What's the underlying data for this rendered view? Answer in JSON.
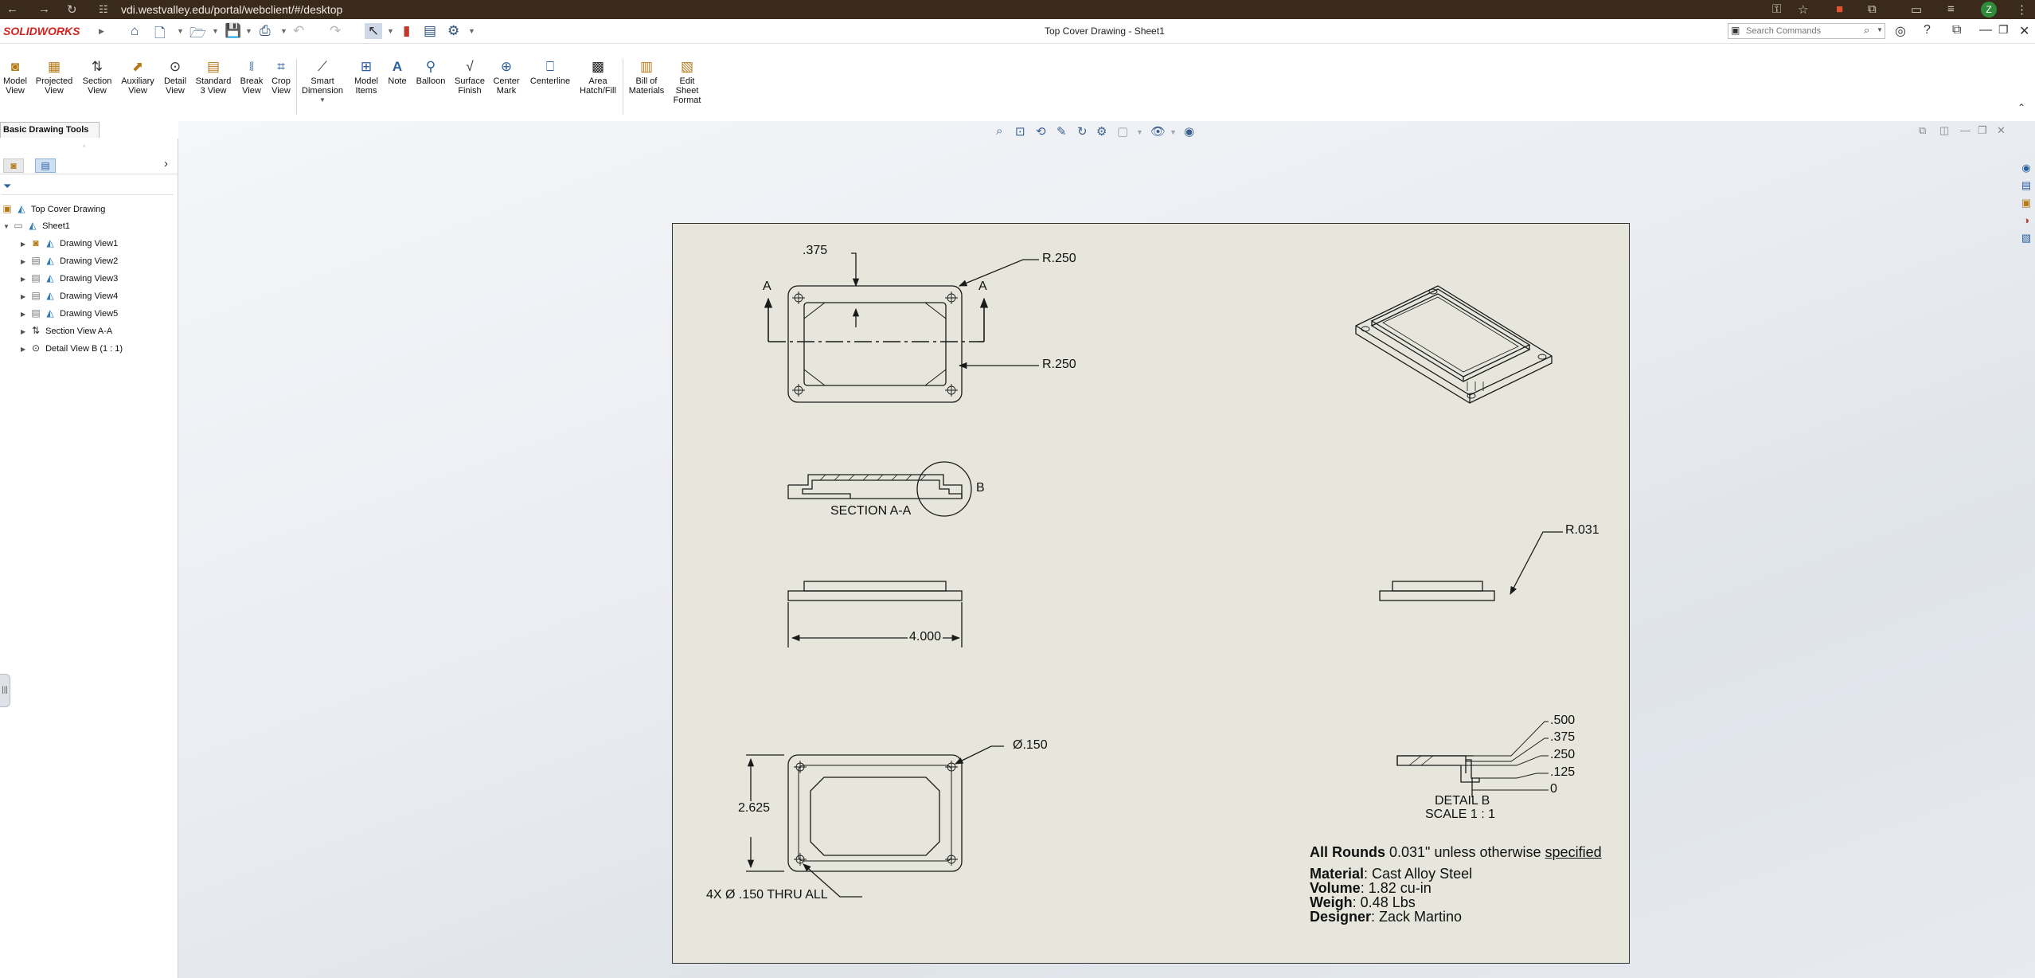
{
  "browser": {
    "url": "vdi.westvalley.edu/portal/webclient/#/desktop",
    "avatar": "Z"
  },
  "app": {
    "logo": "SOLIDWORKS",
    "doc_title": "Top Cover Drawing - Sheet1",
    "search_placeholder": "Search Commands"
  },
  "toolbar": {
    "tools": [
      {
        "label": "Model\nView",
        "icon": "model-view-icon"
      },
      {
        "label": "Projected\nView",
        "icon": "projected-view-icon"
      },
      {
        "label": "Section\nView",
        "icon": "section-view-icon"
      },
      {
        "label": "Auxiliary\nView",
        "icon": "auxiliary-view-icon"
      },
      {
        "label": "Detail\nView",
        "icon": "detail-view-icon"
      },
      {
        "label": "Standard\n3 View",
        "icon": "standard-3-view-icon"
      },
      {
        "label": "Break\nView",
        "icon": "break-view-icon"
      },
      {
        "label": "Crop\nView",
        "icon": "crop-view-icon"
      },
      {
        "label": "Smart\nDimension",
        "icon": "smart-dimension-icon"
      },
      {
        "label": "Model\nItems",
        "icon": "model-items-icon"
      },
      {
        "label": "Note",
        "icon": "note-icon"
      },
      {
        "label": "Balloon",
        "icon": "balloon-icon"
      },
      {
        "label": "Surface\nFinish",
        "icon": "surface-finish-icon"
      },
      {
        "label": "Center\nMark",
        "icon": "center-mark-icon"
      },
      {
        "label": "Centerline",
        "icon": "centerline-icon"
      },
      {
        "label": "Area\nHatch/Fill",
        "icon": "area-hatch-icon"
      },
      {
        "label": "Bill of\nMaterials",
        "icon": "bill-of-materials-icon"
      },
      {
        "label": "Edit\nSheet\nFormat",
        "icon": "edit-sheet-format-icon"
      }
    ],
    "tab_label": "Basic Drawing Tools"
  },
  "tree": {
    "root": "Top Cover Drawing",
    "sheet": "Sheet1",
    "items": [
      "Drawing View1",
      "Drawing View2",
      "Drawing View3",
      "Drawing View4",
      "Drawing View5",
      "Section View A-A",
      "Detail View B (1 : 1)"
    ]
  },
  "drawing": {
    "dims": {
      "d375": ".375",
      "r250_top": "R.250",
      "r250_mid": "R.250",
      "sec_a_left": "A",
      "sec_a_right": "A",
      "section_label": "SECTION A-A",
      "detail_circle": "B",
      "width": "4.000",
      "r031": "R.031",
      "height": "2.625",
      "hole_dia": "Ø.150",
      "hole_callout": "4X  Ø .150 THRU ALL",
      "ord_500": ".500",
      "ord_375": ".375",
      "ord_250": ".250",
      "ord_125": ".125",
      "ord_0": "0",
      "detail_label": "DETAIL B",
      "detail_scale": "SCALE 1 : 1"
    },
    "notes": {
      "rounds_label": "All Rounds",
      "rounds_value": "0.031\" unless otherwise",
      "rounds_specified": "specified",
      "material_label": "Material",
      "material_value": ": Cast Alloy Steel",
      "volume_label": "Volume",
      "volume_value": ": 1.82 cu-in",
      "weight_label": "Weigh",
      "weight_value": ": 0.48 Lbs",
      "designer_label": "Designer",
      "designer_value": ": Zack Martino"
    }
  }
}
